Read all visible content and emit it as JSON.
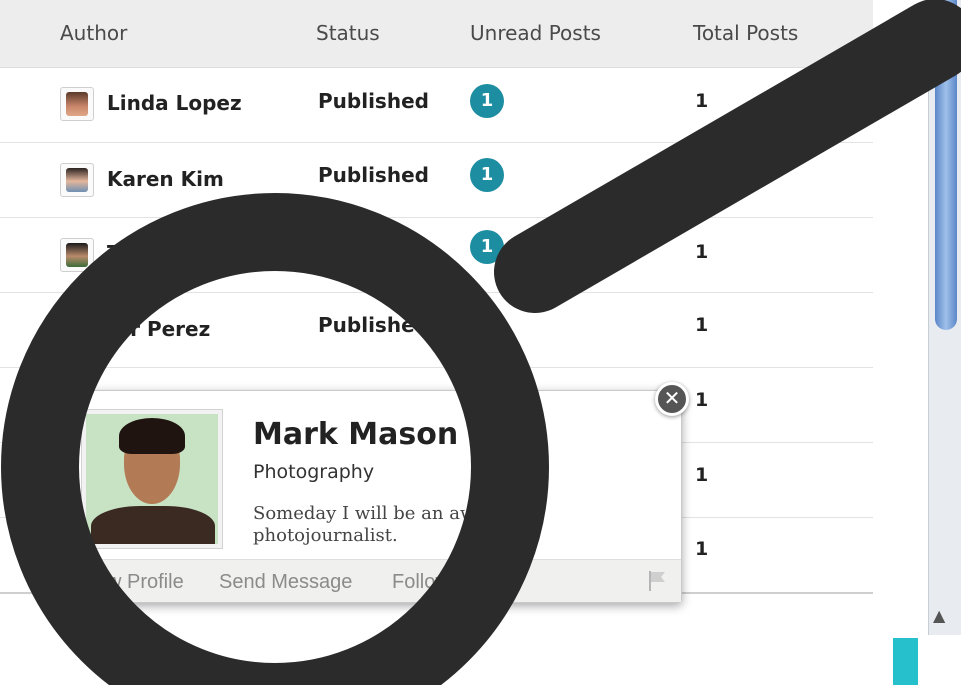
{
  "table": {
    "headers": {
      "author": "Author",
      "status": "Status",
      "unread": "Unread Posts",
      "total": "Total Posts"
    },
    "rows": [
      {
        "author": "Linda Lopez",
        "status": "Published",
        "unread": "1",
        "total": "1"
      },
      {
        "author": "Karen Kim",
        "status": "Published",
        "unread": "1",
        "total": ""
      },
      {
        "author": "T",
        "status": "",
        "unread": "1",
        "total": "1"
      },
      {
        "author": "ter Perez",
        "status": "Published",
        "unread": "",
        "total": "1"
      },
      {
        "author": "",
        "status": "",
        "unread": "",
        "total": "1"
      },
      {
        "author": "",
        "status": "",
        "unread": "",
        "total": "1"
      },
      {
        "author": "",
        "status": "",
        "unread": "",
        "total": "1"
      }
    ]
  },
  "profile_popup": {
    "name": "Mark Mason",
    "department": "Photography",
    "bio": "Someday I will be an awa ning photojournalist.",
    "actions": {
      "view_profile": "w Profile",
      "send_message": "Send Message",
      "follow": "Follow"
    }
  },
  "icons": {
    "close": "close-icon",
    "flag": "flag-icon",
    "magnifier": "magnifier-icon"
  },
  "colors": {
    "badge": "#1d8ea1",
    "scroll_thumb": "#7aa4dc",
    "accent_block": "#25c0cc",
    "magnifier": "#2b2b2b"
  }
}
